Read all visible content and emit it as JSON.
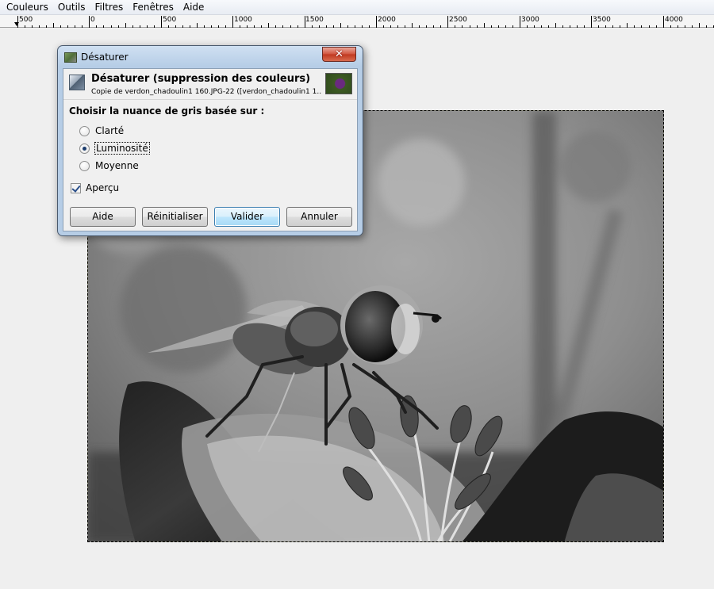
{
  "menubar": {
    "items": [
      {
        "label": "Couleurs"
      },
      {
        "label": "Outils"
      },
      {
        "label": "Filtres"
      },
      {
        "label": "Fenêtres"
      },
      {
        "label": "Aide"
      }
    ]
  },
  "ruler": {
    "labels": [
      "500",
      "0",
      "500",
      "1000",
      "1500",
      "2000",
      "2500",
      "3000",
      "3500",
      "4000"
    ]
  },
  "dialog": {
    "title": "Désaturer",
    "close_symbol": "✕",
    "header_title": "Désaturer (suppression des couleurs)",
    "header_subtitle": "Copie de verdon_chadoulin1 160.JPG-22 ([verdon_chadoulin1 1...",
    "section_label": "Choisir la nuance de gris basée sur :",
    "options": [
      {
        "label": "Clarté",
        "checked": false
      },
      {
        "label": "Luminosité",
        "checked": true
      },
      {
        "label": "Moyenne",
        "checked": false
      }
    ],
    "preview_label": "Aperçu",
    "preview_checked": true,
    "buttons": {
      "help": "Aide",
      "reset": "Réinitialiser",
      "ok": "Valider",
      "cancel": "Annuler"
    }
  },
  "colors": {
    "canvas_background": "#efefef",
    "dialog_frame": "#b6cde6",
    "close_button": "#c0381f",
    "default_button_border": "#3c7fb1"
  }
}
